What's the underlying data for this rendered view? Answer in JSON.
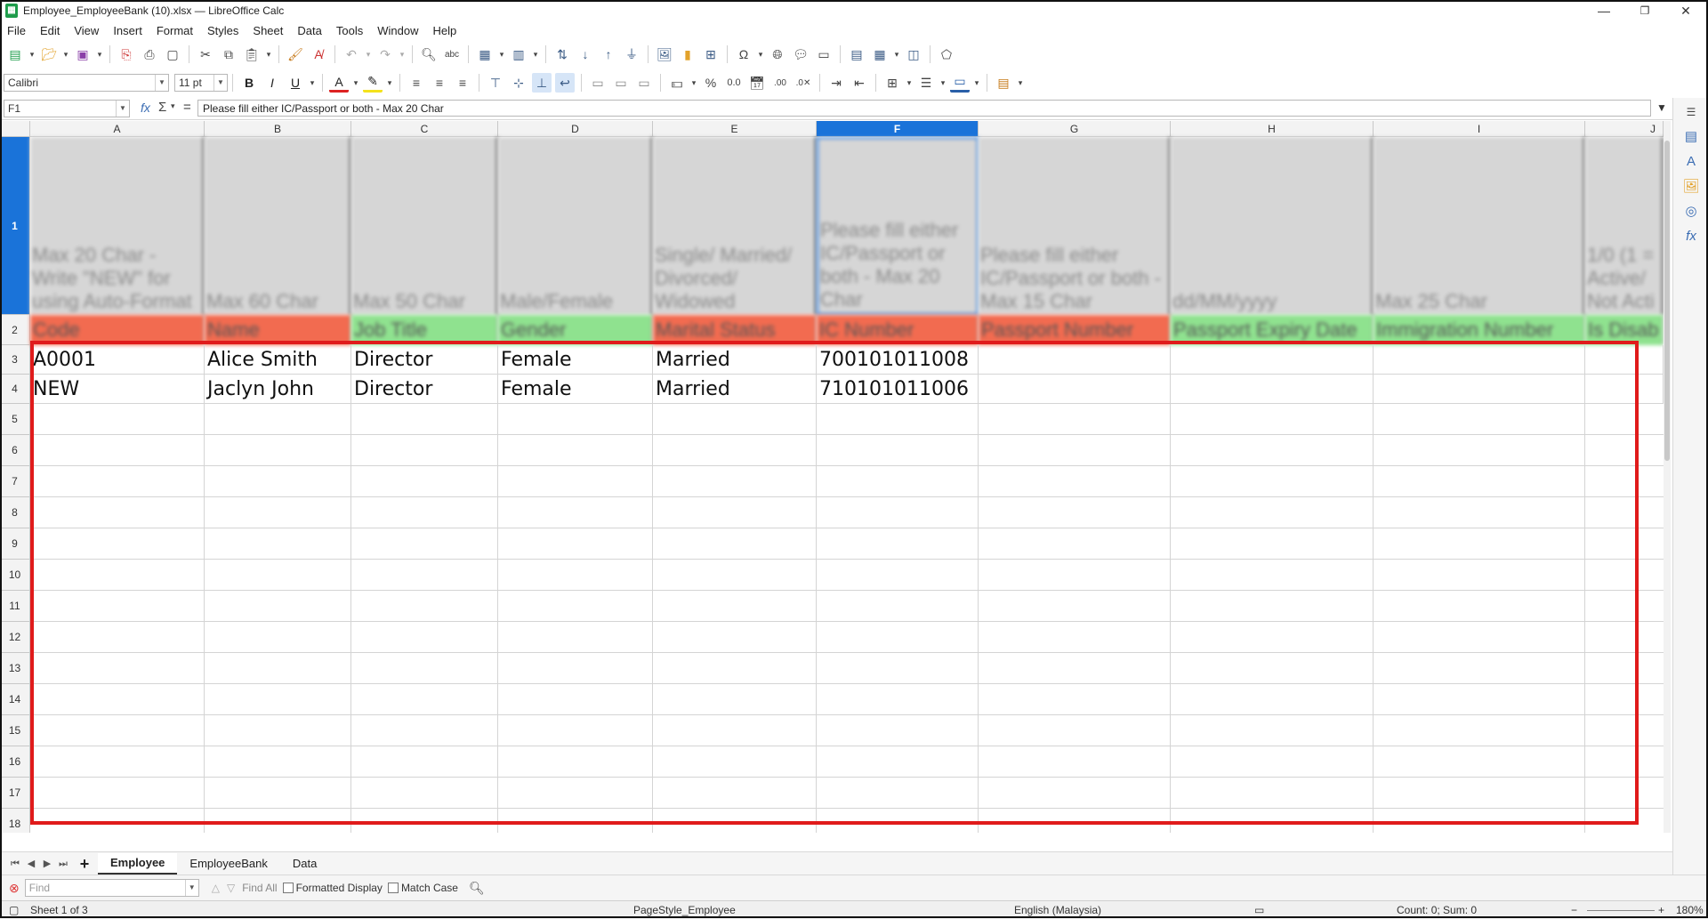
{
  "window": {
    "title": "Employee_EmployeeBank (10).xlsx — LibreOffice Calc",
    "minimize": "—",
    "maximize": "❐",
    "close": "✕"
  },
  "menu": [
    "File",
    "Edit",
    "View",
    "Insert",
    "Format",
    "Styles",
    "Sheet",
    "Data",
    "Tools",
    "Window",
    "Help"
  ],
  "formatting": {
    "font_name": "Calibri",
    "font_size": "11 pt"
  },
  "formula_bar": {
    "cell_ref": "F1",
    "content": "Please fill either IC/Passport or both - Max 20 Char"
  },
  "columns": [
    "A",
    "B",
    "C",
    "D",
    "E",
    "F",
    "G",
    "H",
    "I",
    "J"
  ],
  "selected_column": "F",
  "rows": [
    "1",
    "2",
    "3",
    "4",
    "5",
    "6",
    "7",
    "8",
    "9",
    "10",
    "11",
    "12",
    "13",
    "14",
    "15",
    "16",
    "17",
    "18"
  ],
  "row1_hints": [
    "Max 20 Char - Write \"NEW\" for using Auto-Format",
    "Max 60 Char",
    "Max 50 Char",
    "Male/Female",
    "Single/ Married/ Divorced/ Widowed",
    "Please fill either IC/Passport or both - Max 20 Char",
    "Please fill either IC/Passport or both - Max 15 Char",
    "dd/MM/yyyy",
    "Max 25 Char",
    "1/0 (1 = Active/ Not Acti"
  ],
  "row2_headers": [
    "Code",
    "Name",
    "Job Title",
    "Gender",
    "Marital Status",
    "IC Number",
    "Passport Number",
    "Passport Expiry Date",
    "Immigration Number",
    "Is Disab"
  ],
  "row2_colors": [
    "#f26b50",
    "#f26b50",
    "#8fe28f",
    "#8fe28f",
    "#f26b50",
    "#f26b50",
    "#f26b50",
    "#8fe28f",
    "#8fe28f",
    "#8fe28f"
  ],
  "data_rows": [
    [
      "A0001",
      "Alice Smith",
      "Director",
      "Female",
      "Married",
      "700101011008",
      "",
      "",
      "",
      ""
    ],
    [
      "NEW",
      "Jaclyn John",
      "Director",
      "Female",
      "Married",
      "710101011006",
      "",
      "",
      "",
      ""
    ]
  ],
  "sheet_tabs": [
    "Employee",
    "EmployeeBank",
    "Data"
  ],
  "active_sheet": "Employee",
  "find_bar": {
    "placeholder": "Find",
    "find_all": "Find All",
    "formatted_display": "Formatted Display",
    "match_case": "Match Case"
  },
  "status": {
    "sheet": "Sheet 1 of 3",
    "page_style": "PageStyle_Employee",
    "language": "English (Malaysia)",
    "count_sum": "Count: 0; Sum: 0",
    "zoom": "180%"
  },
  "colors": {
    "selection": "#1a73d9",
    "highlight_box": "#e01b1b"
  }
}
